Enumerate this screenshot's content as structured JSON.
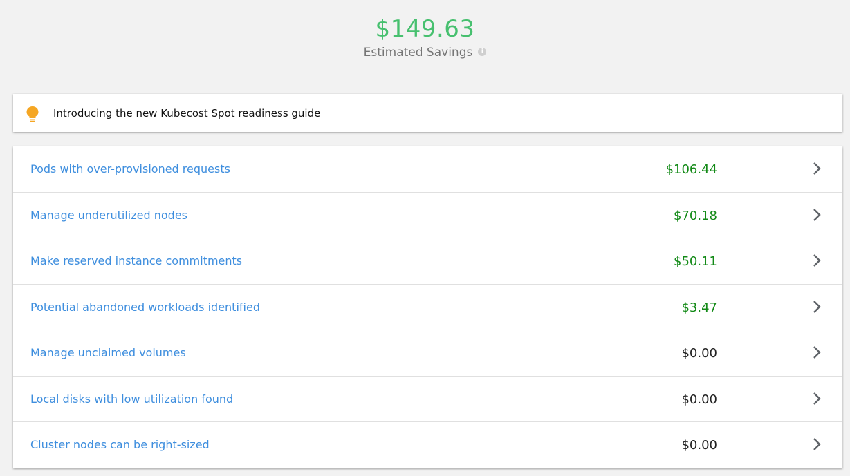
{
  "summary": {
    "total": "$149.63",
    "label": "Estimated Savings",
    "info_icon": "info-icon"
  },
  "banner": {
    "icon": "lightbulb-icon",
    "text": "Introducing the new Kubecost Spot readiness guide"
  },
  "colors": {
    "total": "#47c06f",
    "positive_value": "#138a17",
    "zero_value": "#222222",
    "link": "#3e8ede",
    "bulb": "#f5a623"
  },
  "savings": {
    "items": [
      {
        "label": "Pods with over-provisioned requests",
        "value": "$106.44",
        "status": "positive"
      },
      {
        "label": "Manage underutilized nodes",
        "value": "$70.18",
        "status": "positive"
      },
      {
        "label": "Make reserved instance commitments",
        "value": "$50.11",
        "status": "positive"
      },
      {
        "label": "Potential abandoned workloads identified",
        "value": "$3.47",
        "status": "positive"
      },
      {
        "label": "Manage unclaimed volumes",
        "value": "$0.00",
        "status": "zero"
      },
      {
        "label": "Local disks with low utilization found",
        "value": "$0.00",
        "status": "zero"
      },
      {
        "label": "Cluster nodes can be right-sized",
        "value": "$0.00",
        "status": "zero"
      }
    ]
  }
}
